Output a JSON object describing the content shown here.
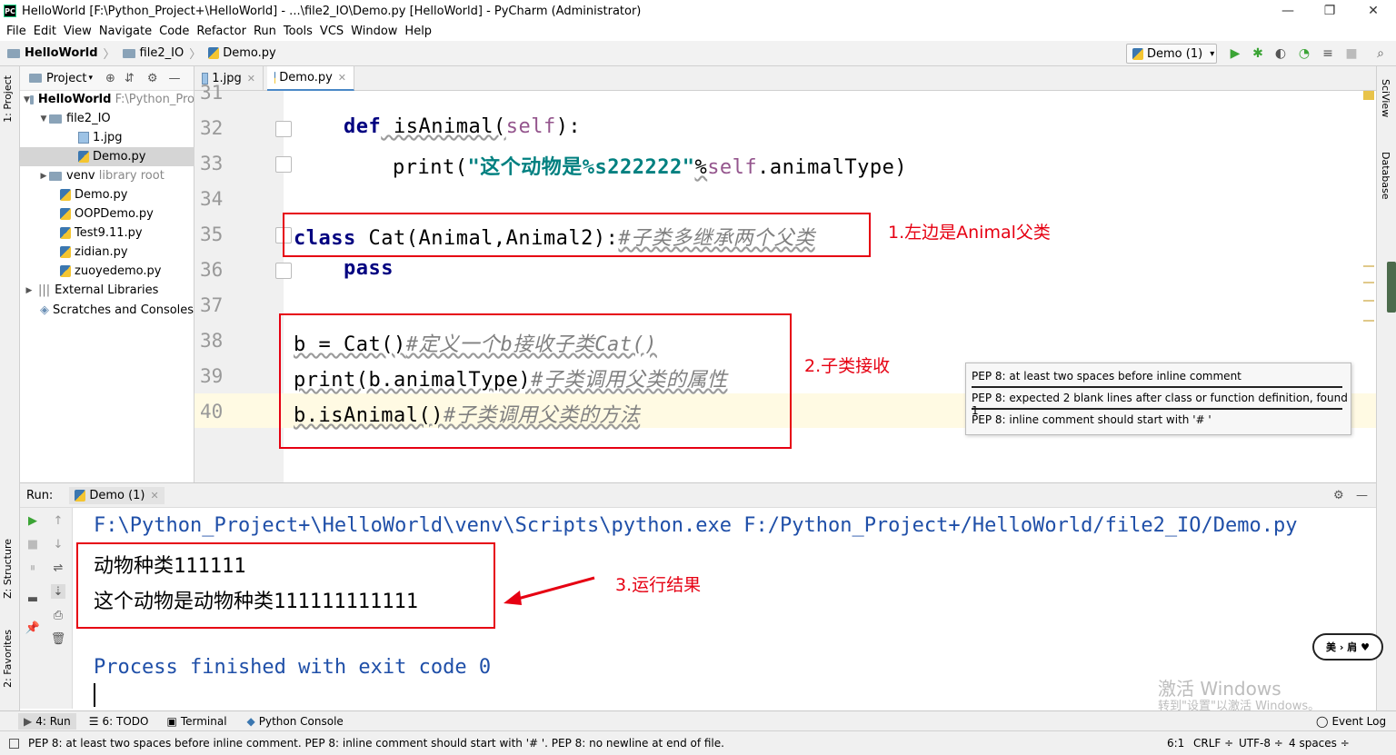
{
  "window": {
    "title": "HelloWorld [F:\\Python_Project+\\HelloWorld] - ...\\file2_IO\\Demo.py [HelloWorld] - PyCharm (Administrator)",
    "minimize": "—",
    "restore": "❐",
    "close": "✕"
  },
  "menu": [
    "File",
    "Edit",
    "View",
    "Navigate",
    "Code",
    "Refactor",
    "Run",
    "Tools",
    "VCS",
    "Window",
    "Help"
  ],
  "breadcrumb": [
    "HelloWorld",
    "file2_IO",
    "Demo.py"
  ],
  "run_config": "Demo (1)",
  "project_panel": {
    "title": "Project",
    "tree": [
      {
        "label": "HelloWorld",
        "extra": "F:\\Python_Pro"
      },
      {
        "label": "file2_IO"
      },
      {
        "label": "1.jpg"
      },
      {
        "label": "Demo.py"
      },
      {
        "label": "venv",
        "extra": "library root"
      },
      {
        "label": "Demo.py"
      },
      {
        "label": "OOPDemo.py"
      },
      {
        "label": "Test9.11.py"
      },
      {
        "label": "zidian.py"
      },
      {
        "label": "zuoyedemo.py"
      },
      {
        "label": "External Libraries"
      },
      {
        "label": "Scratches and Consoles"
      }
    ]
  },
  "left_strip": {
    "project": "1: Project",
    "structure": "Z: Structure",
    "favorites": "2: Favorites"
  },
  "right_strip": {
    "sciview": "SciView",
    "database": "Database"
  },
  "editor_tabs": [
    {
      "label": "1.jpg"
    },
    {
      "label": "Demo.py"
    }
  ],
  "line_numbers": [
    "31",
    "32",
    "33",
    "34",
    "35",
    "36",
    "37",
    "38",
    "39",
    "40"
  ],
  "code": {
    "l32_def": "def",
    "l32_name": " isAnimal(",
    "l32_self": "self",
    "l32_end": "):",
    "l33_print": "print(",
    "l33_str": "\"这个动物是%s222222\"",
    "l33_pct": "%",
    "l33_self": "self",
    "l33_end": ".animalType)",
    "l35_class": "class",
    "l35_name": " Cat(Animal,Animal2):",
    "l35_cmt": "#子类多继承两个父类",
    "l36_pass": "pass",
    "l38_code": "b = Cat()",
    "l38_cmt": "#定义一个b接收子类Cat()",
    "l39_code": "print(b.animalType)",
    "l39_cmt": "#子类调用父类的属性",
    "l40_code": "b.isAnimal()",
    "l40_cmt": "#子类调用父类的方法"
  },
  "annotations": {
    "a1": "1.左边是Animal父类",
    "a2": "2.子类接收",
    "a3": "3.运行结果"
  },
  "tooltip": [
    "PEP 8: at least two spaces before inline comment",
    "PEP 8: expected 2 blank lines after class or function definition, found 1",
    "PEP 8: inline comment should start with '# '"
  ],
  "run_panel": {
    "label": "Run:",
    "tab": "Demo (1)"
  },
  "console": {
    "cmd": "F:\\Python_Project+\\HelloWorld\\venv\\Scripts\\python.exe F:/Python_Project+/HelloWorld/file2_IO/Demo.py",
    "out1": "动物种类111111",
    "out2": "这个动物是动物种类111111111111",
    "finish": "Process finished with exit code 0"
  },
  "bottom_tabs": {
    "run": "4: Run",
    "todo": "6: TODO",
    "terminal": "Terminal",
    "python_console": "Python Console",
    "event_log": "Event Log"
  },
  "status": {
    "message": "PEP 8: at least two spaces before inline comment. PEP 8: inline comment should start with '# '. PEP 8: no newline at end of file.",
    "position": "6:1",
    "line_sep": "CRLF ÷",
    "encoding": "UTF-8 ÷",
    "indent": "4 spaces ÷"
  },
  "watermark": {
    "line1": "激活 Windows",
    "line2": "转到\"设置\"以激活 Windows。"
  },
  "stamp": "美 › 肩 ♥",
  "colors": {
    "accent": "#4a88c7",
    "annotation": "#e60012",
    "keyword": "#000080",
    "string": "#008080",
    "comment": "#808080",
    "run_green": "#3ba435"
  }
}
